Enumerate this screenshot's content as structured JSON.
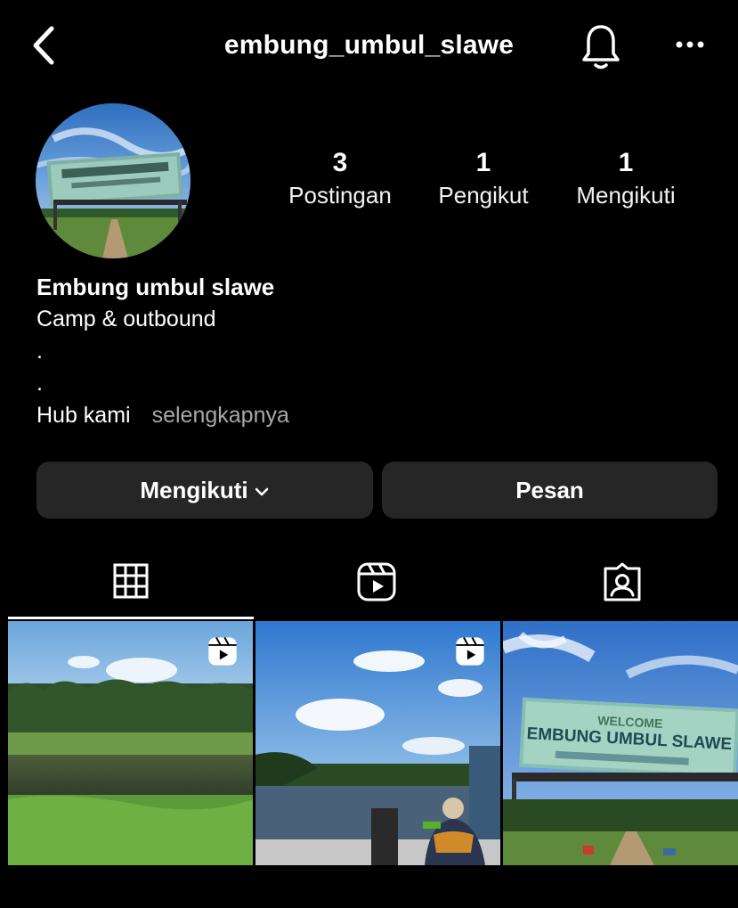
{
  "header": {
    "username": "embung_umbul_slawe"
  },
  "profile": {
    "stats": [
      {
        "count": "3",
        "label": "Postingan"
      },
      {
        "count": "1",
        "label": "Pengikut"
      },
      {
        "count": "1",
        "label": "Mengikuti"
      }
    ],
    "display_name": "Embung umbul slawe",
    "bio_line1": "Camp & outbound",
    "bio_line2": ".",
    "bio_line3": ".",
    "bio_line4": "Hub kami",
    "more_label": "selengkapnya"
  },
  "actions": {
    "follow_label": "Mengikuti",
    "message_label": "Pesan"
  },
  "tabs": [
    {
      "icon": "grid-icon"
    },
    {
      "icon": "reels-icon"
    },
    {
      "icon": "tagged-icon"
    }
  ],
  "posts": [
    {
      "type": "reel",
      "icon": "reels-icon"
    },
    {
      "type": "reel",
      "icon": "reels-icon"
    },
    {
      "type": "photo",
      "sign_text": "EMBUNG UMBUL SLAWE"
    }
  ]
}
